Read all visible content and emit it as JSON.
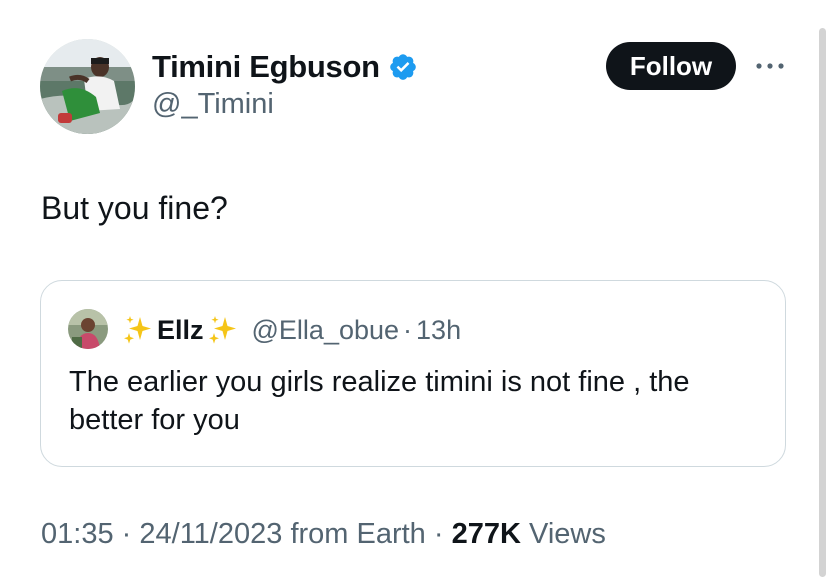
{
  "author": {
    "display_name": "Timini Egbuson",
    "handle": "@_Timini",
    "verified": true
  },
  "follow_button": {
    "label": "Follow"
  },
  "tweet": {
    "text": "But you fine?"
  },
  "quoted_tweet": {
    "display_name": "Ellz",
    "handle": "@Ella_obue",
    "separator": "·",
    "time": "13h",
    "text": "The earlier you girls realize timini is not fine , the better for you"
  },
  "meta": {
    "time": "01:35",
    "dot1": "·",
    "date": "24/11/2023",
    "source": "from Earth",
    "dot2": "·",
    "views_count": "277K",
    "views_label": "Views"
  },
  "colors": {
    "text_primary": "#0f1419",
    "text_secondary": "#536471",
    "verified_blue": "#1d9bf0",
    "border": "#cfd9de",
    "follow_bg": "#0f1419"
  },
  "icons": {
    "verified": "verified-badge-icon",
    "more": "more-horizontal-icon",
    "sparkle": "sparkles-emoji"
  }
}
